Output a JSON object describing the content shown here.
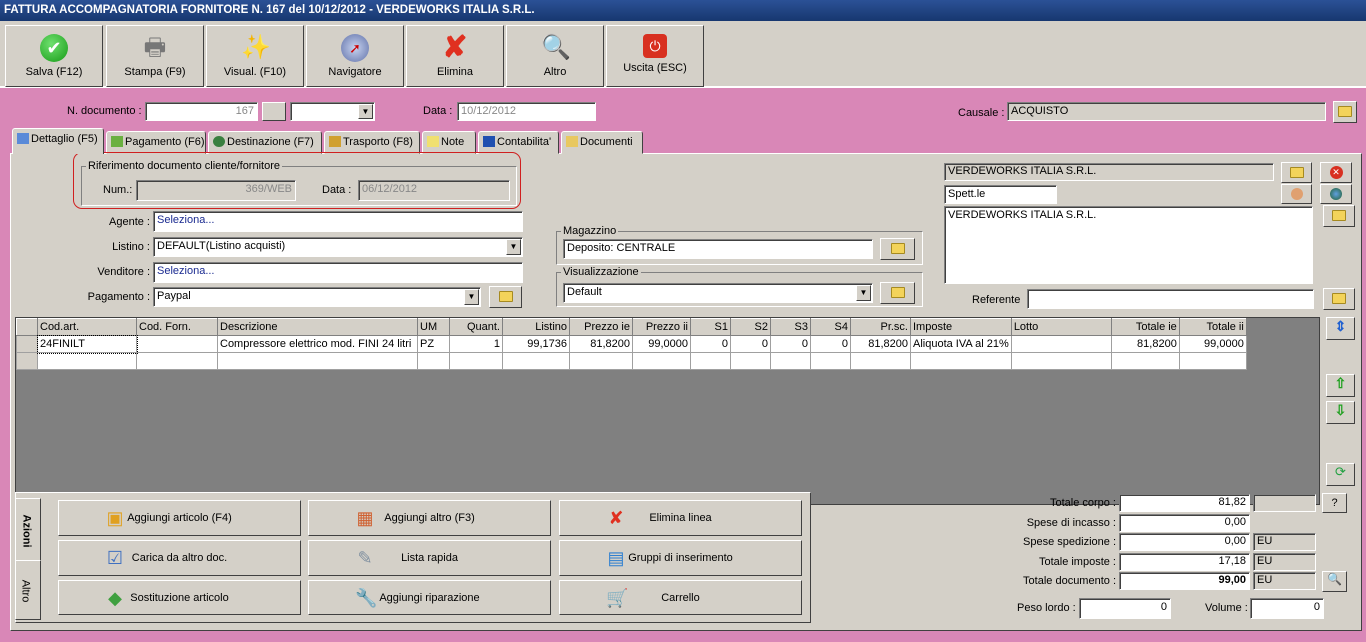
{
  "window": {
    "title": "FATTURA ACCOMPAGNATORIA FORNITORE N. 167  del 10/12/2012 - VERDEWORKS ITALIA S.R.L."
  },
  "toolbar": [
    {
      "label": "Salva (F12)",
      "icon": "check-icon"
    },
    {
      "label": "Stampa (F9)",
      "icon": "printer-icon"
    },
    {
      "label": "Visual. (F10)",
      "icon": "magic-wand-icon"
    },
    {
      "label": "Navigatore",
      "icon": "compass-icon"
    },
    {
      "label": "Elimina",
      "icon": "delete-x-icon"
    },
    {
      "label": "Altro",
      "icon": "book-search-icon"
    },
    {
      "label": "Uscita (ESC)",
      "icon": "power-icon"
    }
  ],
  "header": {
    "ndoc_label": "N. documento :",
    "ndoc_value": "167",
    "data_label": "Data :",
    "data_value": "10/12/2012",
    "causale_label": "Causale :",
    "causale_value": "ACQUISTO"
  },
  "tabs": [
    "Dettaglio (F5)",
    "Pagamento (F6)",
    "Destinazione (F7)",
    "Trasporto (F8)",
    "Note",
    "Contabilita'",
    "Documenti"
  ],
  "riferimento": {
    "legend": "Riferimento documento cliente/fornitore",
    "num_label": "Num.:",
    "num_value": "369/WEB",
    "data_label": "Data :",
    "data_value": "06/12/2012"
  },
  "form": {
    "agente_label": "Agente :",
    "agente_value": "Seleziona...",
    "listino_label": "Listino :",
    "listino_value": "DEFAULT(Listino acquisti)",
    "venditore_label": "Venditore :",
    "venditore_value": "Seleziona...",
    "pagamento_label": "Pagamento :",
    "pagamento_value": "Paypal"
  },
  "magazzino": {
    "legend": "Magazzino",
    "value": "Deposito: CENTRALE"
  },
  "visualizzazione": {
    "legend": "Visualizzazione",
    "value": "Default"
  },
  "cliente": {
    "name": "VERDEWORKS ITALIA S.R.L.",
    "salutation": "Spett.le",
    "address": "VERDEWORKS ITALIA S.R.L.",
    "referente_label": "Referente",
    "referente_value": ""
  },
  "grid": {
    "columns": [
      "Cod.art.",
      "Cod. Forn.",
      "Descrizione",
      "UM",
      "Quant.",
      "Listino",
      "Prezzo ie",
      "Prezzo ii",
      "S1",
      "S2",
      "S3",
      "S4",
      "Pr.sc.",
      "Imposte",
      "Lotto",
      "Totale ie",
      "Totale ii"
    ],
    "rows": [
      [
        "24FINILT",
        "",
        "Compressore elettrico mod. FINI 24 litri",
        "PZ",
        "1",
        "99,1736",
        "81,8200",
        "99,0000",
        "0",
        "0",
        "0",
        "0",
        "81,8200",
        "Aliquota IVA al 21%",
        "",
        "81,8200",
        "99,0000"
      ]
    ]
  },
  "actions_tabs": [
    "Azioni",
    "Altro"
  ],
  "actions": [
    {
      "label": "Aggiungi articolo (F4)",
      "icon": "add-article-icon"
    },
    {
      "label": "Aggiungi altro (F3)",
      "icon": "add-other-icon"
    },
    {
      "label": "Elimina linea",
      "icon": "delete-line-icon"
    },
    {
      "label": "Carica da altro doc.",
      "icon": "load-document-icon"
    },
    {
      "label": "Lista rapida",
      "icon": "quick-list-icon"
    },
    {
      "label": "Gruppi di inserimento",
      "icon": "insert-groups-icon"
    },
    {
      "label": "Sostituzione articolo",
      "icon": "replace-article-icon"
    },
    {
      "label": "Aggiungi riparazione",
      "icon": "wrench-icon"
    },
    {
      "label": "Carrello",
      "icon": "cart-icon"
    }
  ],
  "totals": {
    "corpo_label": "Totale corpo :",
    "corpo": "81,82",
    "incasso_label": "Spese di incasso :",
    "incasso": "0,00",
    "spedizione_label": "Spese spedizione :",
    "spedizione": "0,00",
    "spedizione_cur": "EU",
    "imposte_label": "Totale imposte :",
    "imposte": "17,18",
    "imposte_cur": "EU",
    "documento_label": "Totale documento :",
    "documento": "99,00",
    "documento_cur": "EU",
    "help": "?",
    "peso_label": "Peso lordo :",
    "peso": "0",
    "volume_label": "Volume :",
    "volume": "0"
  }
}
